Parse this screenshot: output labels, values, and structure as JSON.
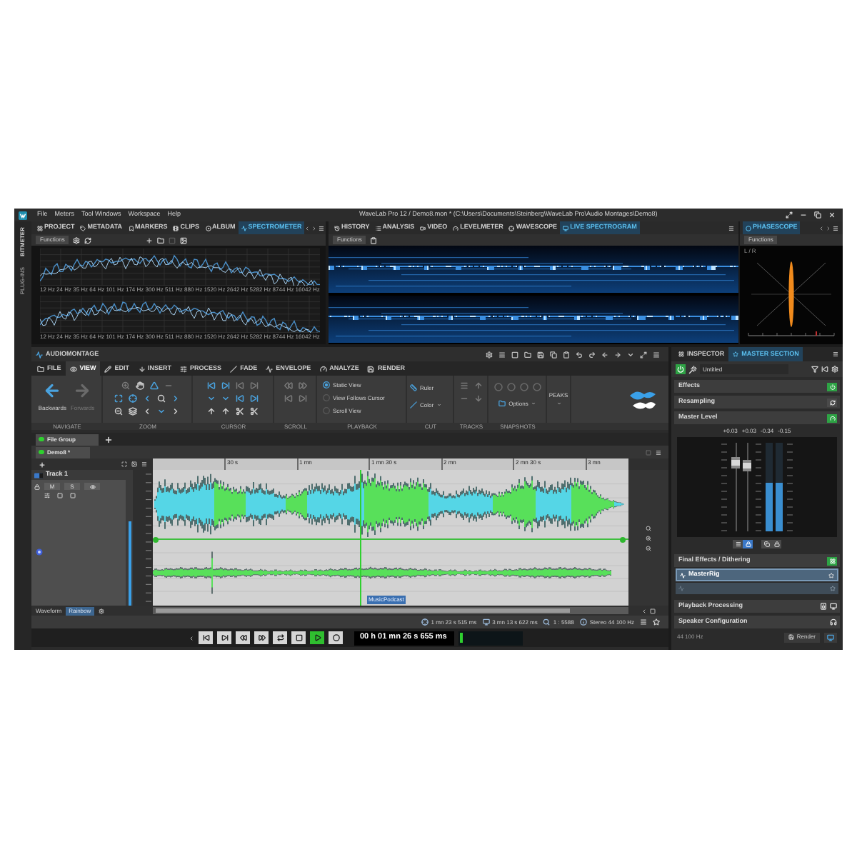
{
  "window": {
    "menu": [
      "File",
      "Meters",
      "Tool Windows",
      "Workspace",
      "Help"
    ],
    "title": "WaveLab Pro 12 / Demo8.mon * (C:\\Users\\Documents\\Steinberg\\WaveLab Pro\\Audio Montages\\Demo8)"
  },
  "side_tabs": [
    "BITMETER",
    "PLUG-INS"
  ],
  "tool_windows": [
    {
      "kind": "spectrometer",
      "tabs": [
        {
          "label": "PROJECT",
          "selected": false
        },
        {
          "label": "METADATA",
          "selected": false
        },
        {
          "label": "MARKERS",
          "selected": false
        },
        {
          "label": "CLIPS",
          "selected": false
        },
        {
          "label": "ALBUM",
          "selected": false
        },
        {
          "label": "SPECTROMETER",
          "selected": true
        }
      ],
      "functions": "Functions",
      "plots": [
        {
          "freq_labels": [
            "12 Hz",
            "24 Hz",
            "35 Hz",
            "64 Hz",
            "101 Hz",
            "174 Hz",
            "300 Hz",
            "511 Hz",
            "880 Hz",
            "1520 Hz",
            "2642 Hz",
            "5282 Hz",
            "8744 Hz",
            "16042 Hz"
          ]
        },
        {
          "freq_labels": [
            "12 Hz",
            "24 Hz",
            "35 Hz",
            "64 Hz",
            "101 Hz",
            "174 Hz",
            "300 Hz",
            "511 Hz",
            "880 Hz",
            "1520 Hz",
            "2642 Hz",
            "5282 Hz",
            "8744 Hz",
            "16042 Hz"
          ]
        }
      ]
    },
    {
      "kind": "spectrogram",
      "tabs": [
        {
          "label": "HISTORY",
          "selected": false
        },
        {
          "label": "ANALYSIS",
          "selected": false
        },
        {
          "label": "VIDEO",
          "selected": false
        },
        {
          "label": "LEVELMETER",
          "selected": false
        },
        {
          "label": "WAVESCOPE",
          "selected": false
        },
        {
          "label": "LIVE SPECTROGRAM",
          "selected": true
        }
      ],
      "functions": "Functions"
    },
    {
      "kind": "phasescope",
      "tabs": [
        {
          "label": "PHASESCOPE",
          "selected": true
        }
      ],
      "functions": "Functions",
      "scope_label": "L / R"
    }
  ],
  "montage": {
    "title": "AUDIOMONTAGE",
    "ribbon_tabs": [
      {
        "label": "FILE",
        "selected": false
      },
      {
        "label": "VIEW",
        "selected": true
      },
      {
        "label": "EDIT",
        "selected": false
      },
      {
        "label": "INSERT",
        "selected": false
      },
      {
        "label": "PROCESS",
        "selected": false
      },
      {
        "label": "FADE",
        "selected": false
      },
      {
        "label": "ENVELOPE",
        "selected": false
      },
      {
        "label": "ANALYZE",
        "selected": false
      },
      {
        "label": "RENDER",
        "selected": false
      }
    ],
    "ribbon_groups": [
      {
        "kind": "navigate",
        "label": "NAVIGATE",
        "buttons": [
          {
            "label": "Backwards",
            "disabled": false
          },
          {
            "label": "Forwards",
            "disabled": true
          }
        ]
      },
      {
        "kind": "zoom",
        "label": "ZOOM"
      },
      {
        "kind": "cursor",
        "label": "CURSOR"
      },
      {
        "kind": "scroll",
        "label": "SCROLL"
      },
      {
        "kind": "playback",
        "label": "PLAYBACK",
        "options": [
          {
            "label": "Static View",
            "selected": true
          },
          {
            "label": "View Follows Cursor",
            "selected": false
          },
          {
            "label": "Scroll View",
            "selected": false
          }
        ]
      },
      {
        "kind": "cut",
        "label": "CUT",
        "items": [
          "Ruler",
          "Color"
        ]
      },
      {
        "kind": "tracks",
        "label": "TRACKS"
      },
      {
        "kind": "snapshots",
        "label": "SNAPSHOTS",
        "button": "Options"
      },
      {
        "kind": "peaks",
        "button": "PEAKS"
      }
    ],
    "group_tabs": [
      {
        "label": "File Group",
        "selected": true
      }
    ],
    "file_tabs": [
      {
        "label": "Demo8 *",
        "selected": true
      }
    ],
    "ruler": [
      "30 s",
      "1 mn",
      "1 mn 30 s",
      "2 mn",
      "2 mn 30 s",
      "3 mn"
    ],
    "track": {
      "name": "Track 1",
      "buttons": [
        "M",
        "S"
      ],
      "meter": {
        "level": 0.62
      },
      "clip": "MusicPodcast"
    },
    "display": {
      "label": "Waveform",
      "modes": [
        {
          "label": "Rainbow",
          "selected": true
        }
      ]
    },
    "status": [
      "1 mn 23 s 515 ms",
      "3 mn 13 s 622 ms",
      "1 : 5588",
      "Stereo 44 100 Hz"
    ],
    "transport": {
      "playing": true,
      "time": "00 h 01 mn 26 s 655 ms",
      "meter": {
        "level": 0.05
      }
    }
  },
  "inspector": {
    "tabs": [
      {
        "label": "INSPECTOR",
        "selected": false
      },
      {
        "label": "MASTER SECTION",
        "selected": true
      }
    ],
    "preset": "Untitled",
    "sections": [
      {
        "label": "Effects",
        "on": true
      },
      {
        "label": "Resampling",
        "on": false
      },
      {
        "label": "Master Level",
        "on": true
      }
    ],
    "readings": [
      "+0.03",
      "+0.03",
      "-0.34",
      "-0.15"
    ],
    "faders": [
      {
        "level": 0.78
      },
      {
        "level": 0.74
      }
    ],
    "meters": [
      {
        "level": 0.55
      },
      {
        "level": 0.55
      }
    ],
    "final_effects": {
      "label": "Final Effects / Dithering",
      "on": true,
      "slots": [
        {
          "kind": "plugin",
          "name": "MasterRig"
        },
        {
          "kind": "empty"
        }
      ]
    },
    "playback_processing": "Playback Processing",
    "speaker_configuration": "Speaker Configuration",
    "sample_rate": "44 100 Hz",
    "render": "Render"
  }
}
